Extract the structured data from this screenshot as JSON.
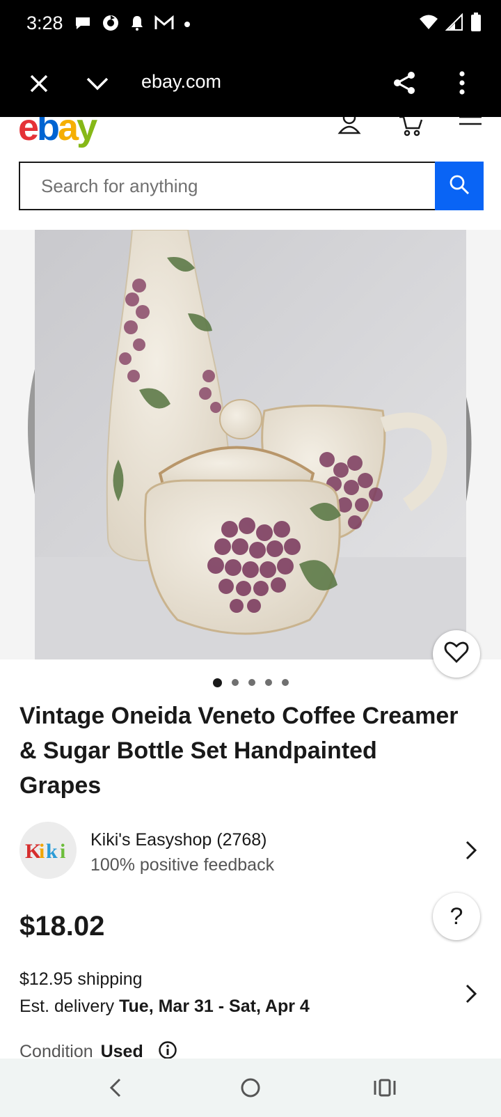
{
  "status_bar": {
    "time": "3:28",
    "left_icons": [
      "chat-bubble-icon",
      "sync-icon",
      "notification-bell-icon",
      "gmail-icon",
      "dot-icon"
    ],
    "right_icons": [
      "wifi-icon",
      "signal-icon",
      "battery-icon"
    ]
  },
  "browser": {
    "url": "ebay.com"
  },
  "search": {
    "placeholder": "Search for anything"
  },
  "gallery": {
    "image_count": 5,
    "active_index": 0
  },
  "listing": {
    "title": "Vintage Oneida Veneto Coffee Creamer & Sugar Bottle Set Handpainted Grapes",
    "price": "$18.02",
    "shipping_price": "$12.95 shipping",
    "delivery_label": "Est. delivery",
    "delivery_dates": "Tue, Mar 31 - Sat, Apr 4",
    "condition_label": "Condition",
    "condition_value": "Used"
  },
  "seller": {
    "name": "Kiki's Easyshop (2768)",
    "feedback": "100% positive feedback",
    "logo_text": "Kiki"
  },
  "help": {
    "label": "?"
  },
  "colors": {
    "accent_blue": "#0964f5",
    "ebay_e": "#e53238",
    "ebay_b": "#0064d2",
    "ebay_a": "#f5af02",
    "ebay_y": "#86b817"
  }
}
